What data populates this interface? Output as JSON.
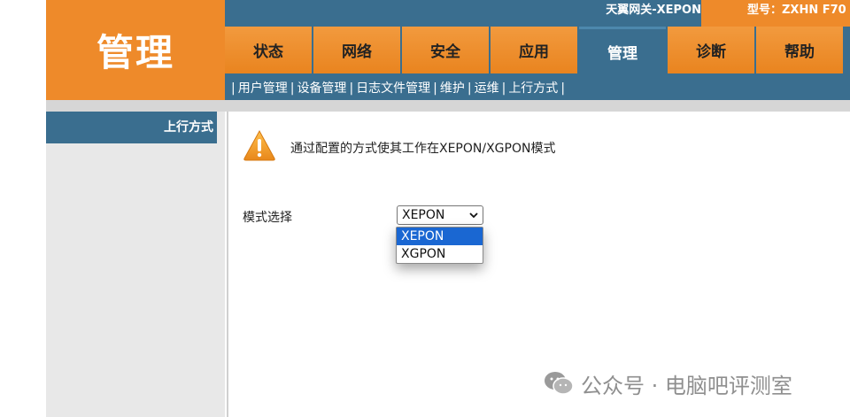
{
  "header": {
    "logo_text": "管理",
    "title": "天翼网关-XEPON",
    "model": "型号：ZXHN F70"
  },
  "nav": {
    "tabs": [
      "状态",
      "网络",
      "安全",
      "应用",
      "管理",
      "诊断",
      "帮助"
    ],
    "active_index": 4
  },
  "subnav": {
    "items": [
      "用户管理",
      "设备管理",
      "日志文件管理",
      "维护",
      "运维",
      "上行方式"
    ]
  },
  "sidebar": {
    "items": [
      {
        "label": "上行方式"
      }
    ]
  },
  "content": {
    "warning_text": "通过配置的方式使其工作在XEPON/XGPON模式",
    "mode_label": "模式选择",
    "select_value": "XEPON",
    "options": [
      "XEPON",
      "XGPON"
    ],
    "highlighted_option": "XEPON"
  },
  "watermark": {
    "text": "公众号 · 电脑吧评测室"
  },
  "colors": {
    "orange": "#ee8a2a",
    "blue": "#3a6e8f",
    "highlight": "#1a67d2"
  }
}
